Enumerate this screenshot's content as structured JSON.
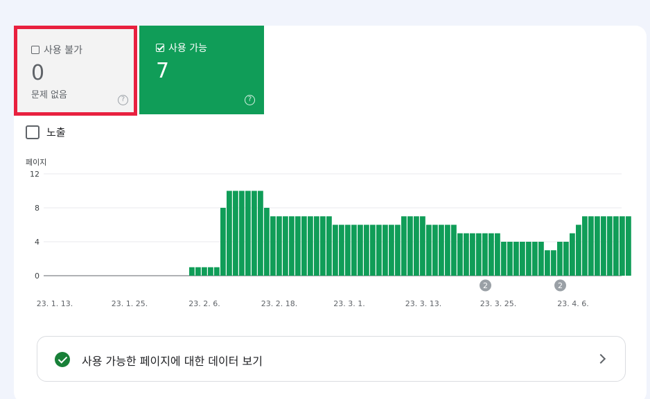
{
  "tiles": {
    "invalid": {
      "label": "사용 불가",
      "count": "0",
      "sub": "문제 없음",
      "help": "?"
    },
    "valid": {
      "label": "사용 가능",
      "count": "7",
      "help": "?"
    }
  },
  "exposure": {
    "label": "노출"
  },
  "footer": {
    "label": "사용 가능한 페이지에 대한 데이터 보기"
  },
  "colors": {
    "bar": "#109d58",
    "highlight": "#e8203f",
    "grid": "#e8eaed"
  },
  "chart_data": {
    "type": "bar",
    "ylabel": "페이지",
    "ylim": [
      0,
      12
    ],
    "yticks": [
      0,
      4,
      8,
      12
    ],
    "xtick_labels": [
      "23. 1. 13.",
      "23. 1. 25.",
      "23. 2. 6.",
      "23. 2. 18.",
      "23. 3. 1.",
      "23. 3. 13.",
      "23. 3. 25.",
      "23. 4. 6."
    ],
    "annotations": [
      {
        "after_day_index": 71,
        "text": "2"
      },
      {
        "after_day_index": 83,
        "text": "2"
      }
    ],
    "values": [
      0,
      0,
      0,
      0,
      0,
      0,
      0,
      0,
      0,
      0,
      0,
      0,
      0,
      0,
      0,
      0,
      0,
      0,
      0,
      0,
      0,
      0,
      0,
      0,
      1,
      1,
      1,
      1,
      1,
      8,
      10,
      10,
      10,
      10,
      10,
      10,
      8,
      7,
      7,
      7,
      7,
      7,
      7,
      7,
      7,
      7,
      7,
      6,
      6,
      6,
      6,
      6,
      6,
      6,
      6,
      6,
      6,
      6,
      7,
      7,
      7,
      7,
      6,
      6,
      6,
      6,
      6,
      5,
      5,
      5,
      5,
      5,
      5,
      5,
      4,
      4,
      4,
      4,
      4,
      4,
      4,
      3,
      3,
      4,
      4,
      5,
      6,
      7,
      7,
      7,
      7,
      7,
      7,
      7,
      7
    ]
  }
}
